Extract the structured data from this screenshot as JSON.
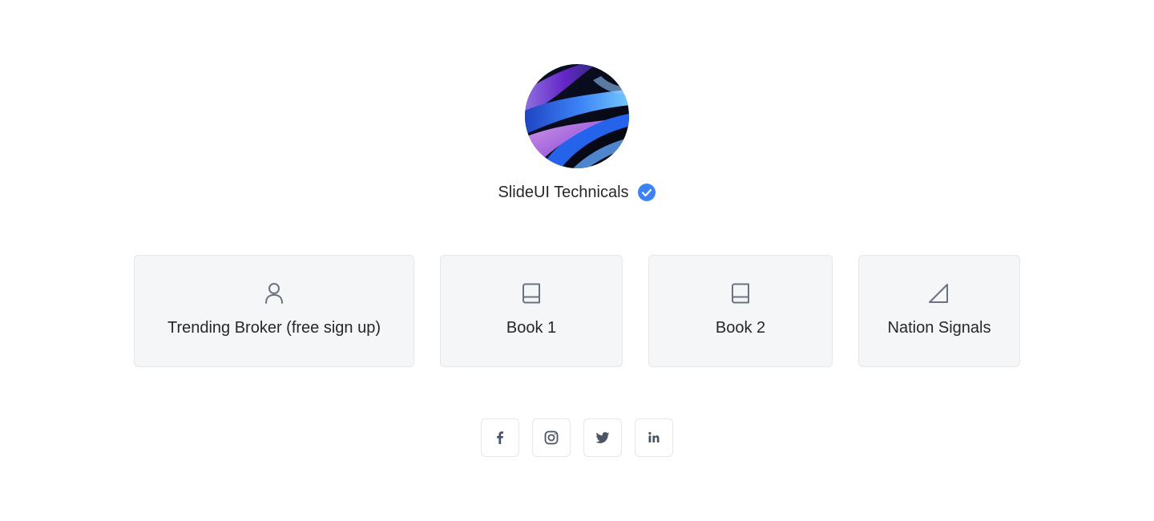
{
  "profile": {
    "name": "SlideUI Technicals",
    "verified_icon": "verified-check-icon",
    "verified_color": "#3b82f6"
  },
  "links": [
    {
      "label": "Trending Broker (free sign up)",
      "icon": "user-icon"
    },
    {
      "label": "Book 1",
      "icon": "book-icon"
    },
    {
      "label": "Book 2",
      "icon": "book-icon"
    },
    {
      "label": "Nation Signals",
      "icon": "signal-icon"
    }
  ],
  "social": [
    {
      "icon": "facebook-icon"
    },
    {
      "icon": "instagram-icon"
    },
    {
      "icon": "twitter-icon"
    },
    {
      "icon": "linkedin-icon"
    }
  ],
  "colors": {
    "card_bg": "#f5f6f8",
    "card_border": "#e5e7eb",
    "icon_gray": "#6b7280",
    "text": "#27272a"
  }
}
